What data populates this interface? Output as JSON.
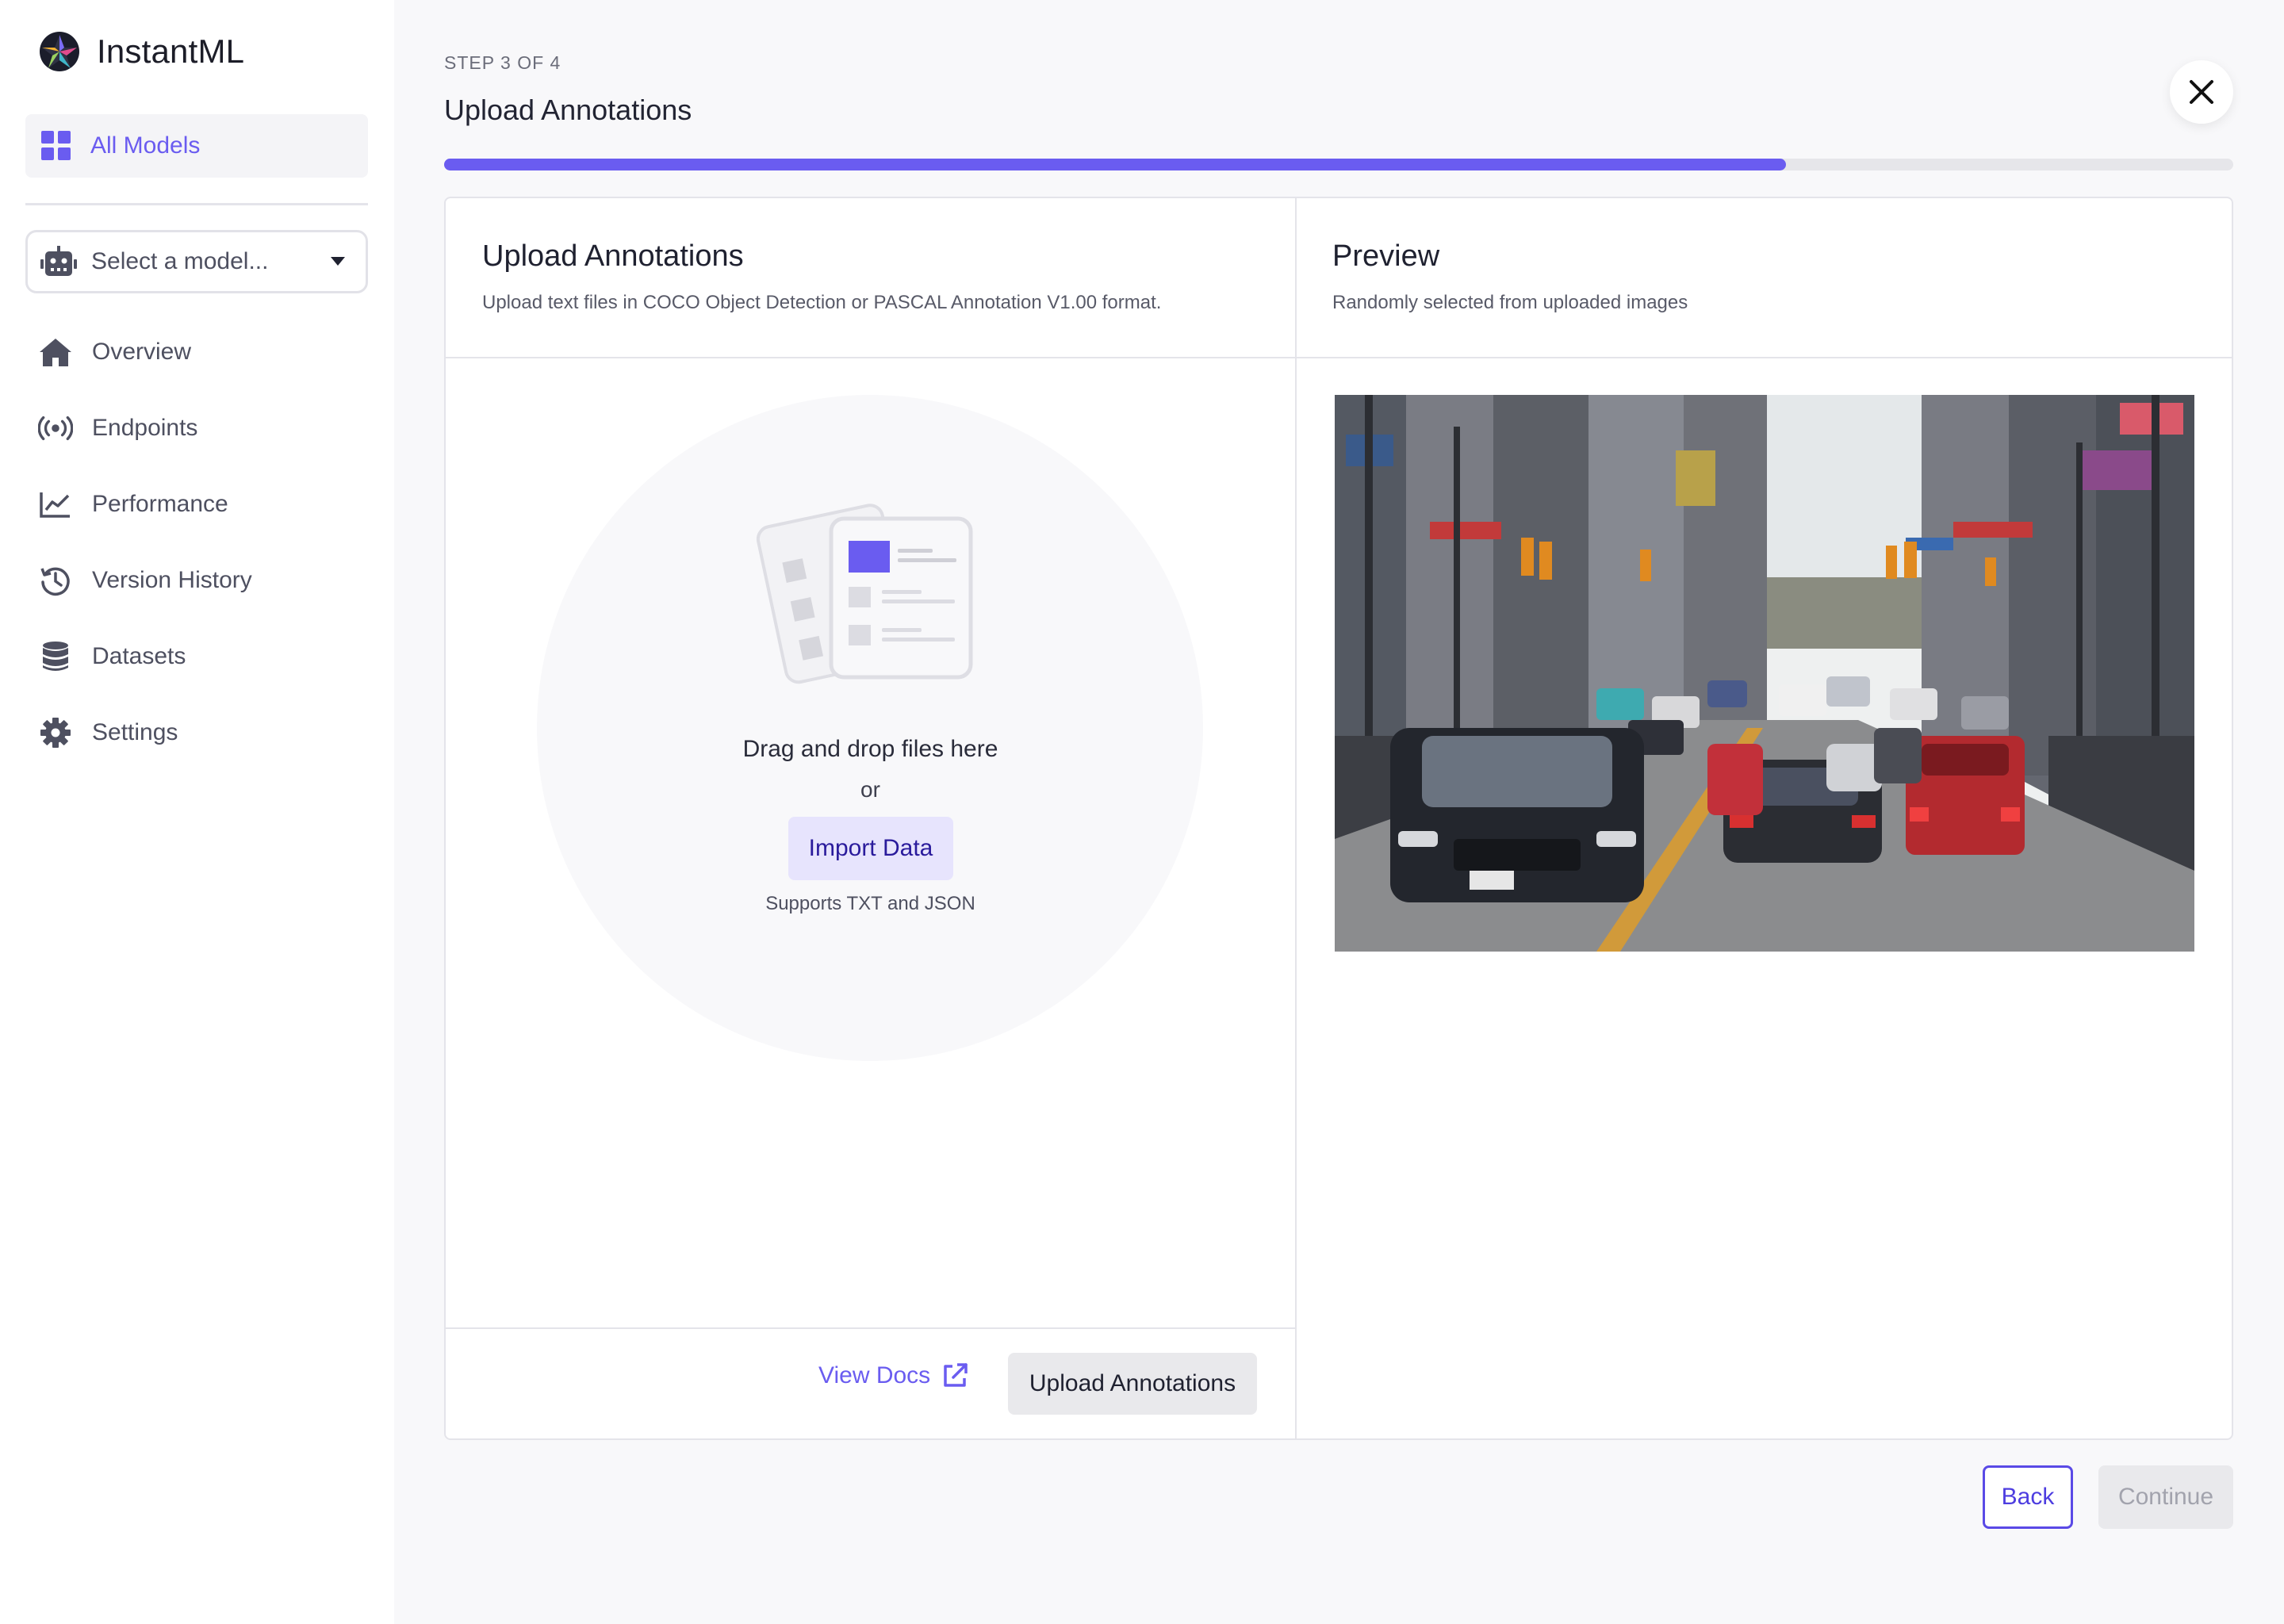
{
  "app": {
    "name": "InstantML"
  },
  "sidebar": {
    "active_item": {
      "label": "All Models",
      "icon": "grid-icon"
    },
    "model_select": {
      "placeholder": "Select a model...",
      "icon": "robot-icon"
    },
    "items": [
      {
        "label": "Overview",
        "icon": "home-icon"
      },
      {
        "label": "Endpoints",
        "icon": "broadcast-icon"
      },
      {
        "label": "Performance",
        "icon": "chart-line-icon"
      },
      {
        "label": "Version History",
        "icon": "history-icon"
      },
      {
        "label": "Datasets",
        "icon": "database-icon"
      },
      {
        "label": "Settings",
        "icon": "gear-icon"
      }
    ]
  },
  "header": {
    "step": "STEP 3 OF 4",
    "title": "Upload Annotations",
    "progress": 0.75
  },
  "upload_panel": {
    "title": "Upload Annotations",
    "subtitle": "Upload text files in COCO Object Detection or PASCAL Annotation V1.00 format.",
    "drop_text": "Drag and drop files here",
    "or_text": "or",
    "import_label": "Import Data",
    "supports_text": "Supports TXT and JSON",
    "docs_label": "View Docs",
    "upload_label": "Upload Annotations"
  },
  "preview_panel": {
    "title": "Preview",
    "subtitle": "Randomly selected from uploaded images"
  },
  "footer": {
    "back_label": "Back",
    "continue_label": "Continue"
  },
  "colors": {
    "accent": "#6a5cf0",
    "accent_light": "#e7e4fd",
    "background": "#f8f8fa"
  }
}
